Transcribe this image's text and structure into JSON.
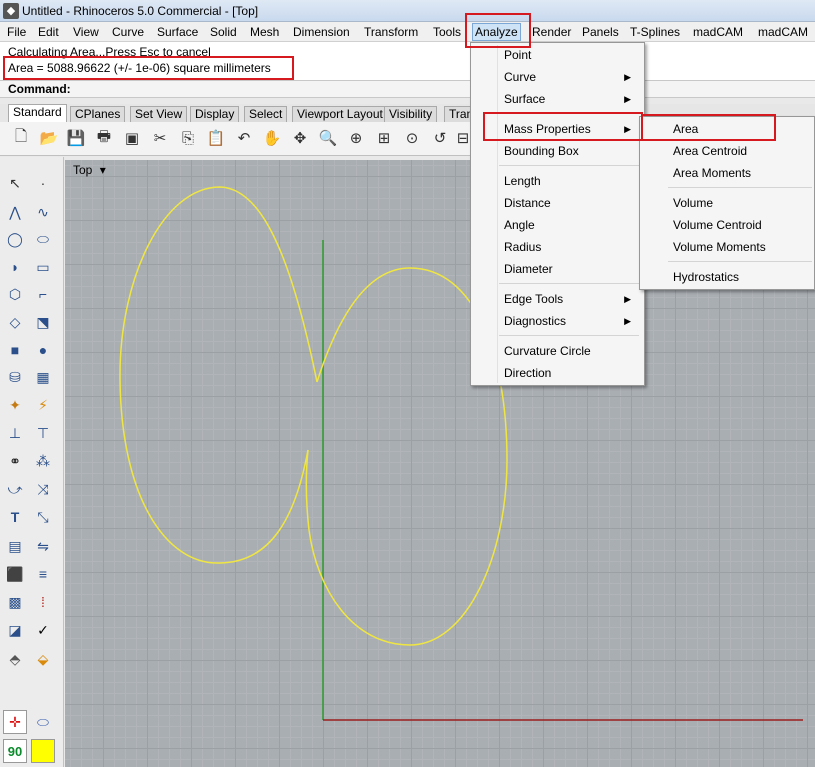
{
  "window": {
    "title": "Untitled - Rhinoceros 5.0 Commercial - [Top]"
  },
  "menubar": [
    "File",
    "Edit",
    "View",
    "Curve",
    "Surface",
    "Solid",
    "Mesh",
    "Dimension",
    "Transform",
    "Tools",
    "Analyze",
    "Render",
    "Panels",
    "T-Splines",
    "madCAM",
    "madCAM"
  ],
  "command": {
    "history_line_1": "Calculating Area...Press Esc to cancel",
    "history_line_2": "Area = 5088.96622 (+/- 1e-06) square millimeters",
    "prompt": "Command:"
  },
  "tabs": [
    "Standard",
    "CPlanes",
    "Set View",
    "Display",
    "Select",
    "Viewport Layout",
    "Visibility",
    "Tran"
  ],
  "viewport": {
    "name": "Top",
    "arrow": "▾"
  },
  "analyze_menu": {
    "items": [
      {
        "label": "Point",
        "has_submenu": false
      },
      {
        "label": "Curve",
        "has_submenu": true
      },
      {
        "label": "Surface",
        "has_submenu": true
      },
      {
        "label": "Mass Properties",
        "has_submenu": true
      },
      {
        "label": "Bounding Box",
        "has_submenu": false
      },
      {
        "label": "Length",
        "has_submenu": false
      },
      {
        "label": "Distance",
        "has_submenu": false
      },
      {
        "label": "Angle",
        "has_submenu": false
      },
      {
        "label": "Radius",
        "has_submenu": false
      },
      {
        "label": "Diameter",
        "has_submenu": false
      },
      {
        "label": "Edge Tools",
        "has_submenu": true
      },
      {
        "label": "Diagnostics",
        "has_submenu": true
      },
      {
        "label": "Curvature Circle",
        "has_submenu": false
      },
      {
        "label": "Direction",
        "has_submenu": false
      }
    ],
    "arrow_glyph": "▶"
  },
  "mass_properties_submenu": [
    "Area",
    "Area Centroid",
    "Area Moments",
    "Volume",
    "Volume Centroid",
    "Volume Moments",
    "Hydrostatics"
  ],
  "status": {
    "angle_snap": "90"
  },
  "colors": {
    "curve": "#f0e641",
    "x_axis": "#9a1f1f",
    "y_axis": "#2f9a2f",
    "highlight": "#d6181f"
  }
}
